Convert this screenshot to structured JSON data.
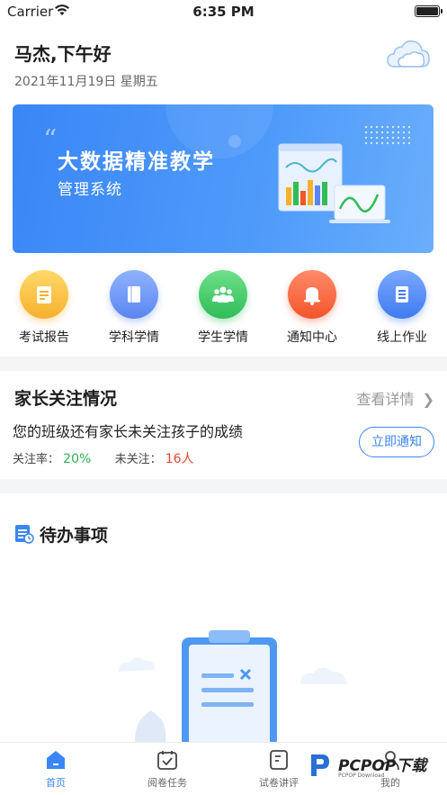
{
  "status_bar": {
    "carrier": "Carrier",
    "time": "6:35 PM"
  },
  "header": {
    "greeting": "马杰,下午好",
    "date": "2021年11月19日 星期五",
    "weather_icon": "cloud-icon"
  },
  "banner": {
    "quote": "“",
    "title": "大数据精准教学",
    "subtitle": "管理系统"
  },
  "quick_menu": [
    {
      "label": "考试报告",
      "icon": "report-icon",
      "color": "#f7b02c"
    },
    {
      "label": "学科学情",
      "icon": "book-icon",
      "color": "#5b86f1"
    },
    {
      "label": "学生学情",
      "icon": "students-icon",
      "color": "#2fbd57"
    },
    {
      "label": "通知中心",
      "icon": "bell-icon",
      "color": "#f4552a"
    },
    {
      "label": "线上作业",
      "icon": "document-icon",
      "color": "#3f7bf0"
    }
  ],
  "parents": {
    "title": "家长关注情况",
    "view_detail": "查看详情",
    "description": "您的班级还有家长未关注孩子的成绩",
    "rate_label": "关注率：",
    "rate_value": "20%",
    "unfollowed_label": "未关注：",
    "unfollowed_value": "16人",
    "notify_button": "立即通知"
  },
  "todo": {
    "title": "待办事项"
  },
  "tab_bar": [
    {
      "label": "首页",
      "icon": "home-icon",
      "active": true
    },
    {
      "label": "阅卷任务",
      "icon": "calendar-check-icon",
      "active": false
    },
    {
      "label": "试卷讲评",
      "icon": "paper-icon",
      "active": false
    },
    {
      "label": "我的",
      "icon": "user-icon",
      "active": false
    }
  ],
  "watermark": {
    "text": "PCPOP下载",
    "sub": "PCPOP Download"
  },
  "colors": {
    "accent": "#3a86f6",
    "green": "#2fae55",
    "red": "#e8452c"
  }
}
